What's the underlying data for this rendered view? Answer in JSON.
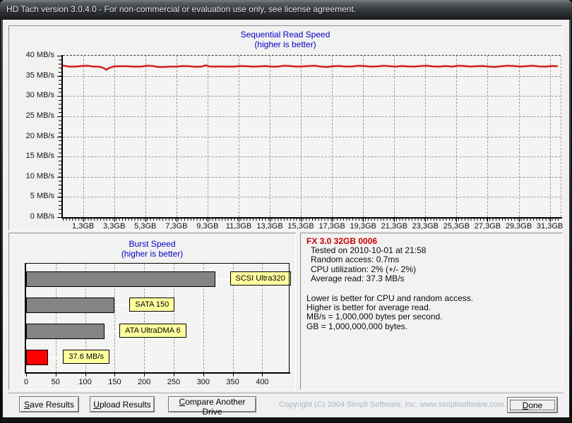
{
  "window": {
    "title": "HD Tach version 3.0.4.0  - For non-commercial or evaluation use only, see license agreement."
  },
  "chart_data": [
    {
      "type": "line",
      "title": "Sequential Read Speed",
      "subtitle": "(higher is better)",
      "ylabel": "MB/s",
      "ylim": [
        0,
        40
      ],
      "y_ticks": [
        0,
        5,
        10,
        15,
        20,
        25,
        30,
        35,
        40
      ],
      "y_unit": " MB/s",
      "xlim_gb": [
        0,
        32
      ],
      "x_tick_values_gb": [
        1.3,
        3.3,
        5.3,
        7.3,
        9.3,
        11.3,
        13.3,
        15.3,
        17.3,
        19.3,
        21.3,
        23.3,
        25.3,
        27.3,
        29.3,
        31.3
      ],
      "x_tick_labels": [
        "1,3GB",
        "3,3GB",
        "5,3GB",
        "7,3GB",
        "9,3GB",
        "11,3GB",
        "13,3GB",
        "15,3GB",
        "17,3GB",
        "19,3GB",
        "21,3GB",
        "23,3GB",
        "25,3GB",
        "27,3GB",
        "29,3GB",
        "31,3GB"
      ],
      "grid": true,
      "legend": "none",
      "series": [
        {
          "name": "sequential read speed",
          "color": "#cc1111",
          "points": [
            [
              0,
              37.55
            ],
            [
              0.4,
              37.3
            ],
            [
              0.8,
              37.3
            ],
            [
              1.2,
              37.45
            ],
            [
              1.6,
              37.5
            ],
            [
              2.0,
              37.3
            ],
            [
              2.3,
              37.3
            ],
            [
              2.6,
              37.0
            ],
            [
              2.8,
              36.5
            ],
            [
              3.0,
              37.0
            ],
            [
              3.3,
              37.35
            ],
            [
              3.7,
              37.4
            ],
            [
              4.1,
              37.4
            ],
            [
              4.5,
              37.3
            ],
            [
              5.0,
              37.3
            ],
            [
              5.4,
              37.5
            ],
            [
              5.8,
              37.45
            ],
            [
              6.1,
              37.2
            ],
            [
              6.5,
              37.2
            ],
            [
              6.9,
              37.3
            ],
            [
              7.3,
              37.3
            ],
            [
              7.7,
              37.45
            ],
            [
              8.1,
              37.4
            ],
            [
              8.5,
              37.25
            ],
            [
              8.9,
              37.3
            ],
            [
              9.2,
              37.6
            ],
            [
              9.4,
              37.35
            ],
            [
              9.8,
              37.3
            ],
            [
              10.2,
              37.35
            ],
            [
              10.6,
              37.3
            ],
            [
              11.0,
              37.3
            ],
            [
              11.4,
              37.45
            ],
            [
              11.8,
              37.4
            ],
            [
              12.2,
              37.3
            ],
            [
              12.6,
              37.35
            ],
            [
              13.0,
              37.45
            ],
            [
              13.4,
              37.3
            ],
            [
              13.8,
              37.3
            ],
            [
              14.2,
              37.5
            ],
            [
              14.6,
              37.45
            ],
            [
              15.0,
              37.3
            ],
            [
              15.4,
              37.35
            ],
            [
              15.8,
              37.45
            ],
            [
              16.2,
              37.5
            ],
            [
              16.6,
              37.3
            ],
            [
              17.0,
              37.2
            ],
            [
              17.4,
              37.4
            ],
            [
              17.8,
              37.45
            ],
            [
              18.2,
              37.3
            ],
            [
              18.6,
              37.35
            ],
            [
              19.0,
              37.5
            ],
            [
              19.4,
              37.45
            ],
            [
              19.8,
              37.3
            ],
            [
              20.2,
              37.35
            ],
            [
              20.6,
              37.5
            ],
            [
              21.0,
              37.4
            ],
            [
              21.4,
              37.3
            ],
            [
              21.8,
              37.45
            ],
            [
              22.2,
              37.35
            ],
            [
              22.6,
              37.3
            ],
            [
              23.0,
              37.45
            ],
            [
              23.4,
              37.5
            ],
            [
              23.8,
              37.35
            ],
            [
              24.2,
              37.3
            ],
            [
              24.6,
              37.45
            ],
            [
              25.0,
              37.3
            ],
            [
              25.4,
              37.5
            ],
            [
              25.8,
              37.45
            ],
            [
              26.2,
              37.3
            ],
            [
              26.6,
              37.4
            ],
            [
              27.0,
              37.45
            ],
            [
              27.4,
              37.3
            ],
            [
              27.8,
              37.2
            ],
            [
              28.2,
              37.4
            ],
            [
              28.6,
              37.5
            ],
            [
              29.0,
              37.45
            ],
            [
              29.4,
              37.3
            ],
            [
              29.8,
              37.4
            ],
            [
              30.2,
              37.5
            ],
            [
              30.6,
              37.35
            ],
            [
              31.0,
              37.3
            ],
            [
              31.4,
              37.45
            ],
            [
              31.8,
              37.4
            ]
          ]
        }
      ]
    },
    {
      "type": "bar",
      "orientation": "horizontal",
      "title": "Burst Speed",
      "subtitle": "(higher is better)",
      "xlim": [
        0,
        445
      ],
      "x_ticks": [
        0,
        50,
        100,
        150,
        200,
        250,
        300,
        350,
        400
      ],
      "grid": true,
      "bars": [
        {
          "label": "SCSI Ultra320",
          "value": 320,
          "color": "#848484"
        },
        {
          "label": "SATA 150",
          "value": 150,
          "color": "#848484"
        },
        {
          "label": "ATA UltraDMA 6",
          "value": 133,
          "color": "#848484"
        },
        {
          "label": "37.6 MB/s",
          "value": 37.6,
          "color": "#ff0000"
        }
      ],
      "callout_bg": "#ffff9e"
    }
  ],
  "info_panel": {
    "title": "FX 3.0 32GB 0006",
    "details": [
      "Tested on 2010-10-01 at 21:58",
      "Random access: 0.7ms",
      "CPU utilization: 2% (+/- 2%)",
      "Average read: 37.3 MB/s"
    ],
    "notes": [
      "Lower is better for CPU and random access.",
      "Higher is better for average read.",
      "MB/s = 1,000,000 bytes per second.",
      "GB = 1,000,000,000 bytes."
    ]
  },
  "footer": {
    "buttons": [
      {
        "label": "Save Results"
      },
      {
        "label": "Upload Results"
      },
      {
        "label": "Compare Another Drive"
      }
    ],
    "done_label": "Done",
    "copyright": "Copyright (C) 2004 Simpli Software, Inc. www.simplisoftware.com"
  },
  "colors": {
    "chart_title": "#0000c8",
    "line": "#cc1111",
    "bar_gray": "#848484",
    "bar_red": "#ff0000",
    "callout_bg": "#ffff9e",
    "drive_title_red": "#cc0000",
    "copyright_text": "#a7b6c4",
    "client_bg": "#f0f0f0"
  }
}
